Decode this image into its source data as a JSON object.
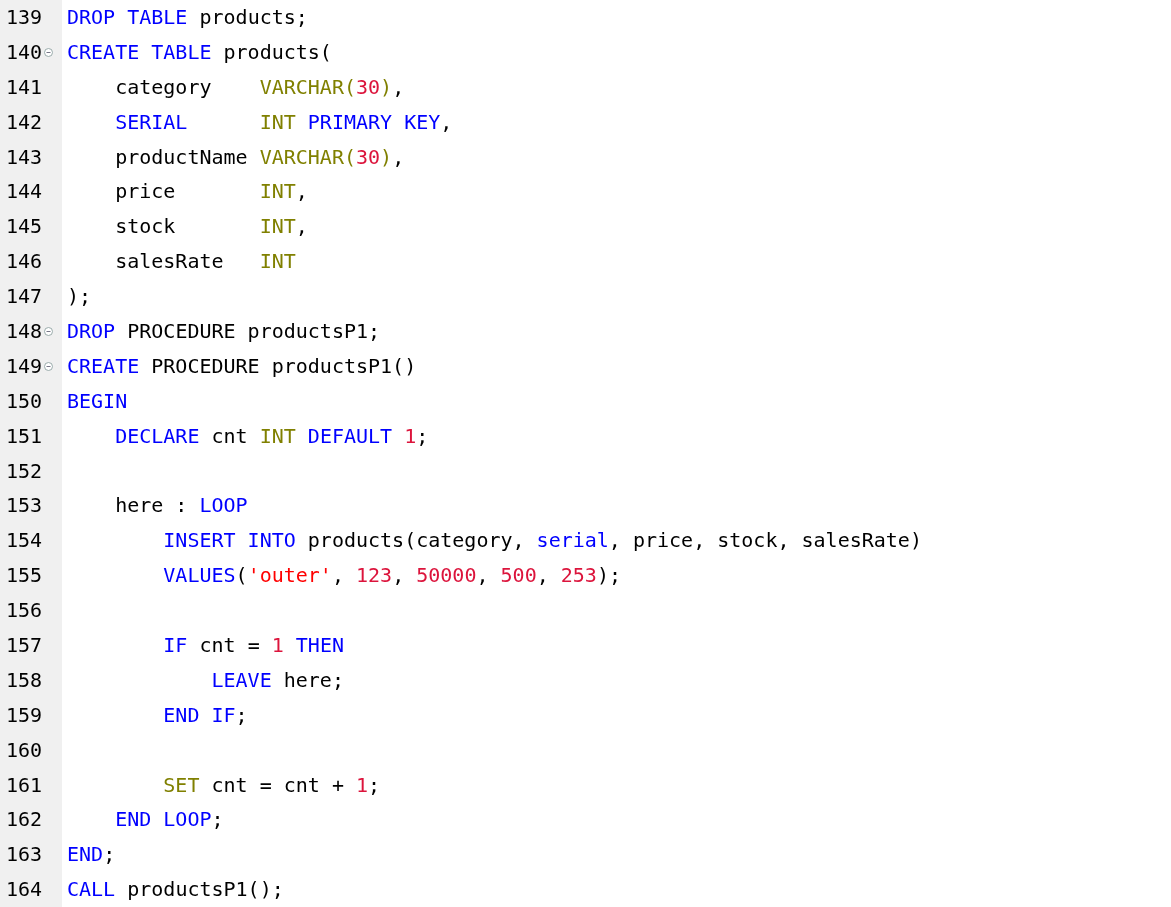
{
  "editor": {
    "lines": [
      {
        "number": "139",
        "foldable": false,
        "tokens": [
          {
            "kind": "keyword",
            "text": "DROP TABLE"
          },
          {
            "kind": "plain",
            "text": " products;"
          }
        ]
      },
      {
        "number": "140",
        "foldable": true,
        "tokens": [
          {
            "kind": "keyword",
            "text": "CREATE TABLE"
          },
          {
            "kind": "plain",
            "text": " products("
          }
        ]
      },
      {
        "number": "141",
        "foldable": false,
        "tokens": [
          {
            "kind": "plain",
            "text": "    category    "
          },
          {
            "kind": "type",
            "text": "VARCHAR("
          },
          {
            "kind": "number",
            "text": "30"
          },
          {
            "kind": "type",
            "text": ")"
          },
          {
            "kind": "plain",
            "text": ","
          }
        ]
      },
      {
        "number": "142",
        "foldable": false,
        "tokens": [
          {
            "kind": "keyword",
            "text": "    SERIAL      "
          },
          {
            "kind": "type",
            "text": "INT "
          },
          {
            "kind": "keyword",
            "text": "PRIMARY KEY"
          },
          {
            "kind": "plain",
            "text": ","
          }
        ]
      },
      {
        "number": "143",
        "foldable": false,
        "tokens": [
          {
            "kind": "plain",
            "text": "    productName "
          },
          {
            "kind": "type",
            "text": "VARCHAR("
          },
          {
            "kind": "number",
            "text": "30"
          },
          {
            "kind": "type",
            "text": ")"
          },
          {
            "kind": "plain",
            "text": ","
          }
        ]
      },
      {
        "number": "144",
        "foldable": false,
        "tokens": [
          {
            "kind": "plain",
            "text": "    price       "
          },
          {
            "kind": "type",
            "text": "INT"
          },
          {
            "kind": "plain",
            "text": ","
          }
        ]
      },
      {
        "number": "145",
        "foldable": false,
        "tokens": [
          {
            "kind": "plain",
            "text": "    stock       "
          },
          {
            "kind": "type",
            "text": "INT"
          },
          {
            "kind": "plain",
            "text": ","
          }
        ]
      },
      {
        "number": "146",
        "foldable": false,
        "tokens": [
          {
            "kind": "plain",
            "text": "    salesRate   "
          },
          {
            "kind": "type",
            "text": "INT"
          }
        ]
      },
      {
        "number": "147",
        "foldable": false,
        "tokens": [
          {
            "kind": "plain",
            "text": ");"
          }
        ]
      },
      {
        "number": "148",
        "foldable": true,
        "tokens": [
          {
            "kind": "keyword",
            "text": "DROP"
          },
          {
            "kind": "plain",
            "text": " PROCEDURE productsP1;"
          }
        ]
      },
      {
        "number": "149",
        "foldable": true,
        "tokens": [
          {
            "kind": "keyword",
            "text": "CREATE"
          },
          {
            "kind": "plain",
            "text": " PROCEDURE productsP1()"
          }
        ]
      },
      {
        "number": "150",
        "foldable": false,
        "tokens": [
          {
            "kind": "keyword",
            "text": "BEGIN"
          }
        ]
      },
      {
        "number": "151",
        "foldable": false,
        "tokens": [
          {
            "kind": "keyword",
            "text": "    DECLARE"
          },
          {
            "kind": "plain",
            "text": " cnt "
          },
          {
            "kind": "type",
            "text": "INT "
          },
          {
            "kind": "keyword",
            "text": "DEFAULT "
          },
          {
            "kind": "number",
            "text": "1"
          },
          {
            "kind": "plain",
            "text": ";"
          }
        ]
      },
      {
        "number": "152",
        "foldable": false
      },
      {
        "number": "153",
        "foldable": false,
        "tokens": [
          {
            "kind": "plain",
            "text": "    here : "
          },
          {
            "kind": "keyword",
            "text": "LOOP"
          }
        ]
      },
      {
        "number": "154",
        "foldable": false,
        "tokens": [
          {
            "kind": "keyword",
            "text": "        INSERT INTO"
          },
          {
            "kind": "plain",
            "text": " products(category, "
          },
          {
            "kind": "keyword",
            "text": "serial"
          },
          {
            "kind": "plain",
            "text": ", price, stock, salesRate)"
          }
        ]
      },
      {
        "number": "155",
        "foldable": false,
        "tokens": [
          {
            "kind": "keyword",
            "text": "        VALUES"
          },
          {
            "kind": "plain",
            "text": "("
          },
          {
            "kind": "string",
            "text": "'outer'"
          },
          {
            "kind": "plain",
            "text": ", "
          },
          {
            "kind": "number",
            "text": "123"
          },
          {
            "kind": "plain",
            "text": ", "
          },
          {
            "kind": "number",
            "text": "50000"
          },
          {
            "kind": "plain",
            "text": ", "
          },
          {
            "kind": "number",
            "text": "500"
          },
          {
            "kind": "plain",
            "text": ", "
          },
          {
            "kind": "number",
            "text": "253"
          },
          {
            "kind": "plain",
            "text": ");"
          }
        ]
      },
      {
        "number": "156",
        "foldable": false
      },
      {
        "number": "157",
        "foldable": false,
        "tokens": [
          {
            "kind": "keyword",
            "text": "        IF"
          },
          {
            "kind": "plain",
            "text": " cnt = "
          },
          {
            "kind": "number",
            "text": "1"
          },
          {
            "kind": "keyword",
            "text": " THEN"
          }
        ]
      },
      {
        "number": "158",
        "foldable": false,
        "tokens": [
          {
            "kind": "keyword",
            "text": "            LEAVE"
          },
          {
            "kind": "plain",
            "text": " here;"
          }
        ]
      },
      {
        "number": "159",
        "foldable": false,
        "tokens": [
          {
            "kind": "keyword",
            "text": "        END IF"
          },
          {
            "kind": "plain",
            "text": ";"
          }
        ]
      },
      {
        "number": "160",
        "foldable": false
      },
      {
        "number": "161",
        "foldable": false,
        "tokens": [
          {
            "kind": "type",
            "text": "        SET"
          },
          {
            "kind": "plain",
            "text": " cnt = cnt + "
          },
          {
            "kind": "number",
            "text": "1"
          },
          {
            "kind": "plain",
            "text": ";"
          }
        ]
      },
      {
        "number": "162",
        "foldable": false,
        "tokens": [
          {
            "kind": "keyword",
            "text": "    END LOOP"
          },
          {
            "kind": "plain",
            "text": ";"
          }
        ]
      },
      {
        "number": "163",
        "foldable": false,
        "tokens": [
          {
            "kind": "keyword",
            "text": "END"
          },
          {
            "kind": "plain",
            "text": ";"
          }
        ]
      },
      {
        "number": "164",
        "foldable": false,
        "tokens": [
          {
            "kind": "keyword",
            "text": "CALL"
          },
          {
            "kind": "plain",
            "text": " productsP1();"
          }
        ]
      }
    ]
  }
}
